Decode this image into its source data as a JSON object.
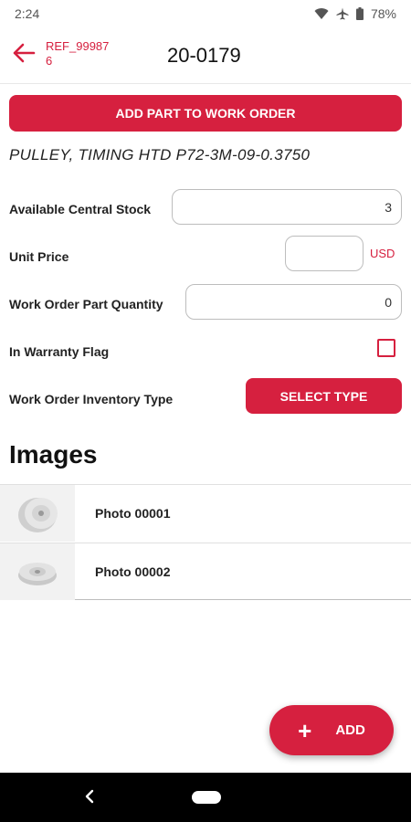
{
  "status_bar": {
    "time": "2:24",
    "battery": "78%",
    "icons": [
      "wifi-icon",
      "airplane-icon",
      "battery-icon"
    ]
  },
  "app_bar": {
    "back_icon": "arrow-left-icon",
    "ref": "REF_999876",
    "title": "20-0179"
  },
  "actions": {
    "add_part_label": "ADD PART TO WORK ORDER"
  },
  "part": {
    "description": "PULLEY, TIMING HTD P72-3M-09-0.3750"
  },
  "form": {
    "available_stock": {
      "label": "Available Central Stock",
      "value": "3"
    },
    "unit_price": {
      "label": "Unit Price",
      "value": "",
      "currency": "USD"
    },
    "quantity": {
      "label": "Work Order Part Quantity",
      "value": "0"
    },
    "warranty": {
      "label": "In Warranty Flag",
      "checked": false
    },
    "inventory_type": {
      "label": "Work Order Inventory Type",
      "button_label": "SELECT TYPE"
    }
  },
  "images": {
    "heading": "Images",
    "items": [
      {
        "label": "Photo 00001"
      },
      {
        "label": "Photo 00002"
      }
    ]
  },
  "fab": {
    "icon": "plus-icon",
    "label": "ADD"
  },
  "colors": {
    "accent": "#d6203f",
    "nav_bar": "#000000"
  }
}
